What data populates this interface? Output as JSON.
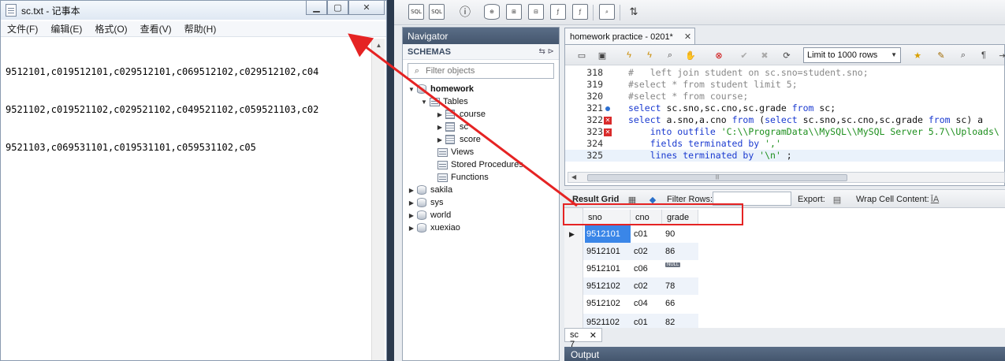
{
  "notepad": {
    "title": "sc.txt - 记事本",
    "menu": [
      "文件(F)",
      "编辑(E)",
      "格式(O)",
      "查看(V)",
      "帮助(H)"
    ],
    "lines": [
      "9512101,c019512101,c029512101,c069512102,c029512102,c04",
      "9521102,c019521102,c029521102,c049521102,c059521103,c02",
      "9521103,c069531101,c019531101,c059531102,c05"
    ]
  },
  "navigator": {
    "header": "Navigator",
    "schemas_label": "SCHEMAS",
    "filter_placeholder": "Filter objects",
    "tree": {
      "homework": "homework",
      "tables": "Tables",
      "course": "course",
      "sc": "sc",
      "score": "score",
      "views": "Views",
      "procs": "Stored Procedures",
      "functions": "Functions",
      "sakila": "sakila",
      "sys": "sys",
      "world": "world",
      "xuexiao": "xuexiao"
    }
  },
  "editor": {
    "tab_label": "homework practice - 0201*",
    "limit_label": "Limit to 1000 rows",
    "lines": [
      {
        "num": "318",
        "marker": ""
      },
      {
        "num": "319",
        "marker": ""
      },
      {
        "num": "320",
        "marker": ""
      },
      {
        "num": "321",
        "marker": "dot"
      },
      {
        "num": "322",
        "marker": "err"
      },
      {
        "num": "323",
        "marker": "err"
      },
      {
        "num": "324",
        "marker": ""
      },
      {
        "num": "325",
        "marker": ""
      }
    ],
    "code": {
      "l318": "#   left join student on sc.sno=student.sno;",
      "l319": "#select * from student limit 5;",
      "l320": "#select * from course;",
      "l321a": "select",
      "l321b": " sc.sno,sc.cno,sc.grade ",
      "l321c": "from",
      "l321d": " sc;",
      "l322a": "select",
      "l322b": " a.sno,a.cno ",
      "l322c": "from",
      "l322d": " (",
      "l322e": "select",
      "l322f": " sc.sno,sc.cno,sc.grade ",
      "l322g": "from",
      "l322h": " sc) a",
      "l323a": "    into outfile ",
      "l323b": "'C:\\\\ProgramData\\\\MySQL\\\\MySQL Server 5.7\\\\Uploads\\",
      "l324a": "    fields terminated by ",
      "l324b": "','",
      "l325a": "    lines terminated by ",
      "l325b": "'\\n'",
      "l325c": " ;"
    }
  },
  "result": {
    "grid_label": "Result Grid",
    "filter_label": "Filter Rows:",
    "export_label": "Export:",
    "wrap_label": "Wrap Cell Content:",
    "columns": [
      "sno",
      "cno",
      "grade"
    ],
    "rows": [
      [
        "9512101",
        "c01",
        "90"
      ],
      [
        "9512101",
        "c02",
        "86"
      ],
      [
        "9512101",
        "c06",
        "NULL"
      ],
      [
        "9512102",
        "c02",
        "78"
      ],
      [
        "9512102",
        "c04",
        "66"
      ],
      [
        "9521102",
        "c01",
        "82"
      ]
    ],
    "tab_label": "sc 7",
    "output_label": "Output"
  },
  "colors": {
    "annotation": "#e52323",
    "selection": "#3a86e8"
  }
}
